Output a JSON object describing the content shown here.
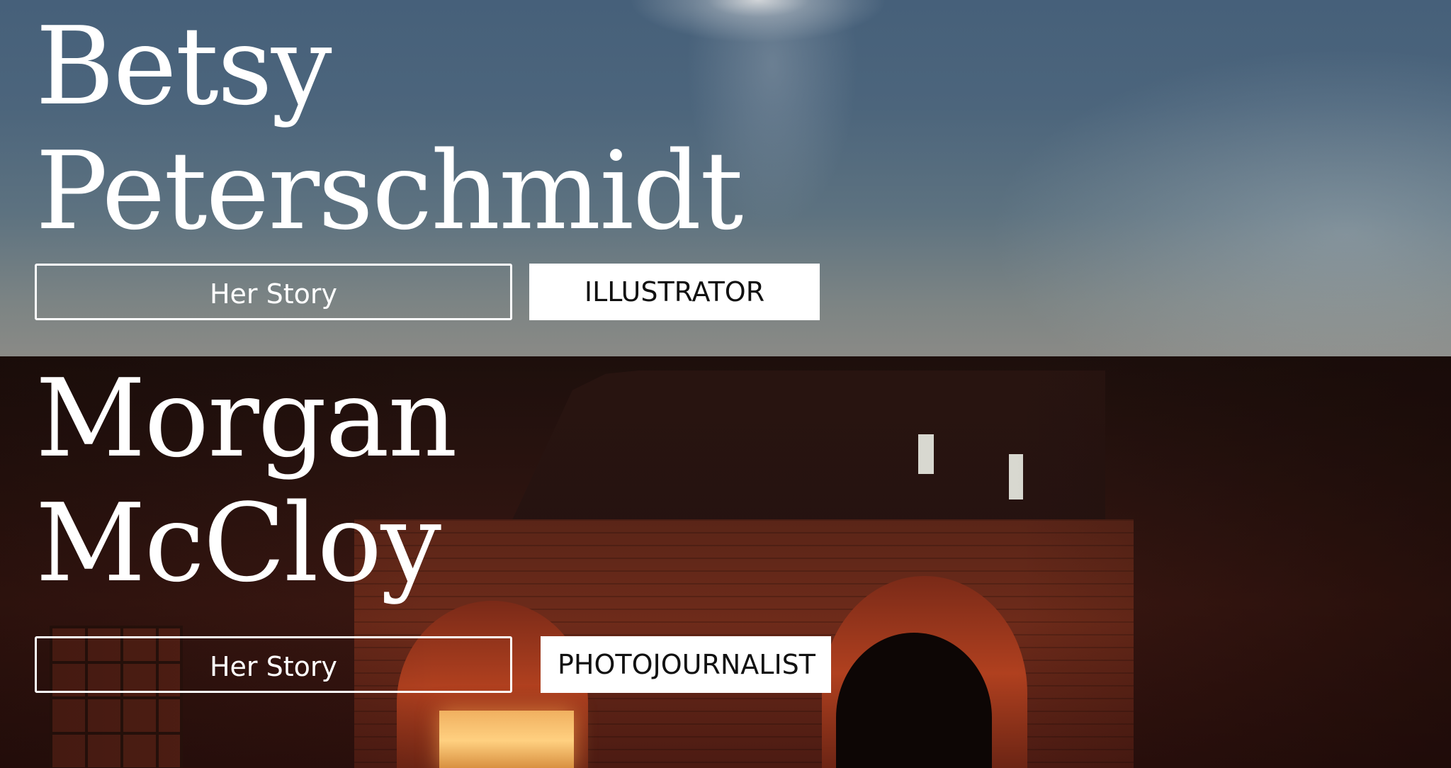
{
  "people": [
    {
      "first_name": "Betsy",
      "last_name": "Peterschmidt",
      "story_button": "Her Story",
      "role_button": "ILLUSTRATOR"
    },
    {
      "first_name": "Morgan",
      "last_name": "McCloy",
      "story_button": "Her Story",
      "role_button": "PHOTOJOURNALIST"
    }
  ],
  "images": {
    "panel_1": "dusk-sky-photo",
    "panel_2": "brick-building-night-photo"
  },
  "colors": {
    "text": "#ffffff",
    "button_fill": "#ffffff",
    "button_text": "#111111"
  }
}
